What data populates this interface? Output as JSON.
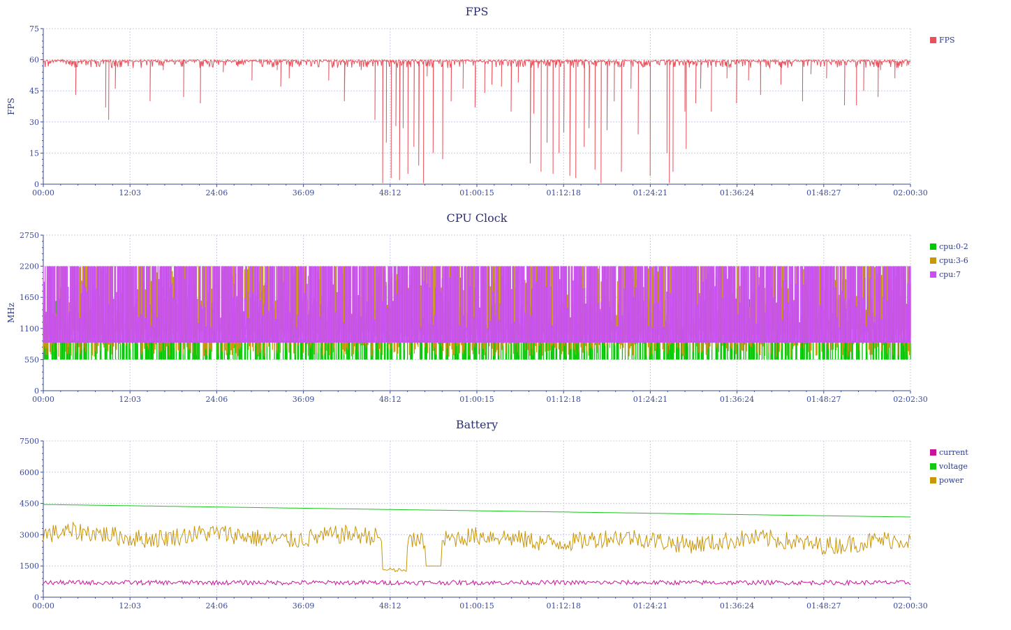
{
  "colors": {
    "fps": "#e8505b",
    "cpu_0_2": "#00c800",
    "cpu_3_6": "#c8960a",
    "cpu_7": "#c850f0",
    "current": "#c8149b",
    "voltage": "#14c814",
    "power": "#c8960a",
    "axis": "#3a4a9a",
    "grid": "#c8cde6"
  },
  "chart_data": [
    {
      "id": "fps",
      "type": "line",
      "title": "FPS",
      "ylabel": "FPS",
      "xlabel": "",
      "ylim": [
        0,
        75
      ],
      "yticks": [
        "0",
        "15",
        "30",
        "45",
        "60",
        "75"
      ],
      "xlim": [
        0,
        7230
      ],
      "xticks": [
        "00:00",
        "12:03",
        "24:06",
        "36:09",
        "48:12",
        "01:00:15",
        "01:12:18",
        "01:24:21",
        "01:36:24",
        "01:48:27",
        "02:00:30"
      ],
      "grid": true,
      "legend_position": "top-right",
      "series": [
        {
          "name": "FPS",
          "color_key": "fps",
          "baseline": 60,
          "dips": [
            [
              270,
              43
            ],
            [
              520,
              37
            ],
            [
              545,
              31
            ],
            [
              600,
              46
            ],
            [
              890,
              40
            ],
            [
              1000,
              55
            ],
            [
              1170,
              42
            ],
            [
              1310,
              39
            ],
            [
              1500,
              54
            ],
            [
              1740,
              50
            ],
            [
              1950,
              55
            ],
            [
              1980,
              47
            ],
            [
              2050,
              51
            ],
            [
              2380,
              50
            ],
            [
              2510,
              40
            ],
            [
              2650,
              55
            ],
            [
              2765,
              31
            ],
            [
              2900,
              53
            ],
            [
              3200,
              52
            ],
            [
              3520,
              58
            ],
            [
              3680,
              44
            ],
            [
              2830,
              0.5
            ],
            [
              2860,
              20
            ],
            [
              2900,
              3
            ],
            [
              2940,
              28
            ],
            [
              2970,
              2
            ],
            [
              3000,
              27
            ],
            [
              3040,
              5
            ],
            [
              3090,
              18
            ],
            [
              3130,
              9
            ],
            [
              3170,
              0.5
            ],
            [
              3250,
              15
            ],
            [
              3330,
              12
            ],
            [
              3400,
              40
            ],
            [
              3500,
              46
            ],
            [
              3600,
              37
            ],
            [
              3740,
              48
            ],
            [
              3820,
              47
            ],
            [
              3900,
              35
            ],
            [
              3960,
              49
            ],
            [
              4060,
              10
            ],
            [
              4090,
              34
            ],
            [
              4150,
              6
            ],
            [
              4200,
              20
            ],
            [
              4250,
              5
            ],
            [
              4300,
              15
            ],
            [
              4340,
              25
            ],
            [
              4390,
              4
            ],
            [
              4440,
              3
            ],
            [
              4510,
              18
            ],
            [
              4550,
              27
            ],
            [
              4600,
              7
            ],
            [
              4650,
              0.5
            ],
            [
              4700,
              26
            ],
            [
              4760,
              40
            ],
            [
              4820,
              6
            ],
            [
              4900,
              46
            ],
            [
              4960,
              24
            ],
            [
              5060,
              4
            ],
            [
              5200,
              15
            ],
            [
              5250,
              6
            ],
            [
              5360,
              17
            ],
            [
              5350,
              35
            ],
            [
              5440,
              39
            ],
            [
              5480,
              46
            ],
            [
              5570,
              35
            ],
            [
              5700,
              51
            ],
            [
              5780,
              39
            ],
            [
              5880,
              50
            ],
            [
              5980,
              43
            ],
            [
              6150,
              48
            ],
            [
              6330,
              40
            ],
            [
              6400,
              53
            ],
            [
              6530,
              51
            ],
            [
              6680,
              38
            ],
            [
              6780,
              38
            ],
            [
              6840,
              45
            ],
            [
              6960,
              42
            ],
            [
              6980,
              55
            ],
            [
              7100,
              51
            ],
            [
              7200,
              57
            ],
            [
              5220,
              0.5
            ]
          ]
        }
      ]
    },
    {
      "id": "cpu",
      "type": "line",
      "title": "CPU Clock",
      "ylabel": "MHz",
      "xlabel": "",
      "ylim": [
        0,
        2750
      ],
      "yticks": [
        "0",
        "550",
        "1100",
        "1650",
        "2200",
        "2750"
      ],
      "xlim": [
        0,
        7230
      ],
      "xticks": [
        "00:00",
        "12:03",
        "24:06",
        "36:09",
        "48:12",
        "01:00:15",
        "01:12:18",
        "01:24:21",
        "01:36:24",
        "01:48:27",
        "02:02:30"
      ],
      "grid": true,
      "legend_position": "top-right",
      "series": [
        {
          "name": "cpu:0-2",
          "color_key": "cpu_0_2",
          "low": 550,
          "high": 850
        },
        {
          "name": "cpu:3-6",
          "color_key": "cpu_3_6",
          "low": 600,
          "high": 2200
        },
        {
          "name": "cpu:7",
          "color_key": "cpu_7",
          "low": 850,
          "high": 2200
        }
      ]
    },
    {
      "id": "battery",
      "type": "line",
      "title": "Battery",
      "ylabel": "",
      "xlabel": "",
      "ylim": [
        0,
        7500
      ],
      "yticks": [
        "0",
        "1500",
        "3000",
        "4500",
        "6000",
        "7500"
      ],
      "xlim": [
        0,
        7230
      ],
      "xticks": [
        "00:00",
        "12:03",
        "24:06",
        "36:09",
        "48:12",
        "01:00:15",
        "01:12:18",
        "01:24:21",
        "01:36:24",
        "01:48:27",
        "02:00:30"
      ],
      "grid": true,
      "legend_position": "top-right",
      "series": [
        {
          "name": "current",
          "color_key": "current",
          "start": 700,
          "end": 700
        },
        {
          "name": "voltage",
          "color_key": "voltage",
          "start": 4450,
          "end": 3850
        },
        {
          "name": "power",
          "color_key": "power",
          "start": 3000,
          "end": 2600
        }
      ]
    }
  ]
}
